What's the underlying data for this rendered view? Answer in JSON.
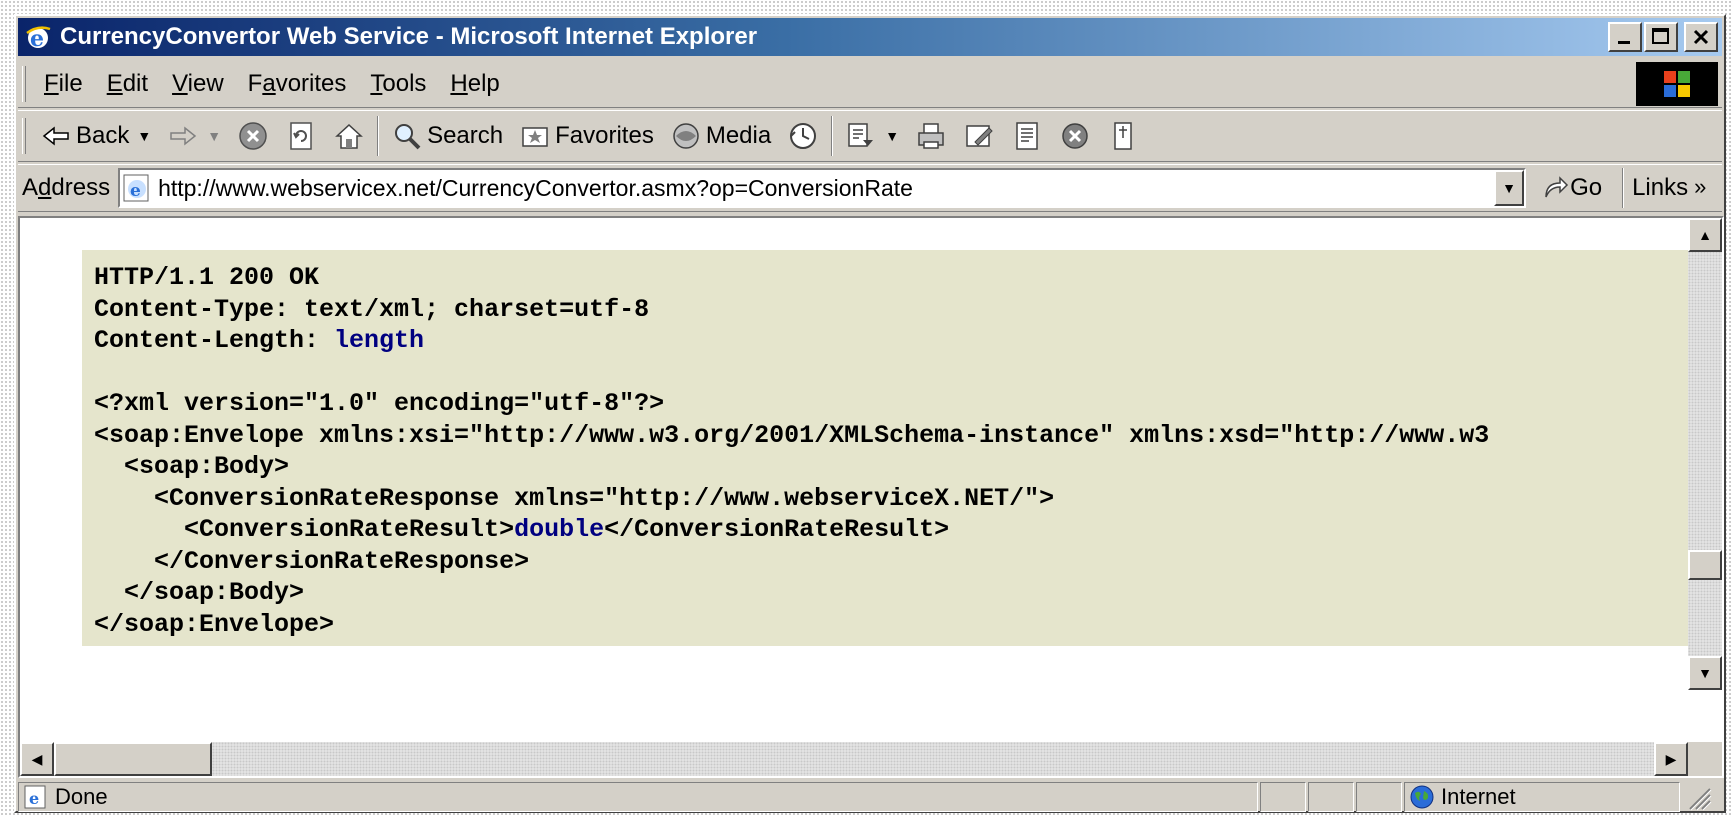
{
  "window": {
    "title": "CurrencyConvertor Web Service - Microsoft Internet Explorer",
    "controls": {
      "minimize": "_",
      "maximize": "□",
      "close": "✕"
    }
  },
  "menu": {
    "items": [
      {
        "prefix": "",
        "accel": "F",
        "rest": "ile"
      },
      {
        "prefix": "",
        "accel": "E",
        "rest": "dit"
      },
      {
        "prefix": "",
        "accel": "V",
        "rest": "iew"
      },
      {
        "prefix": "F",
        "accel": "a",
        "rest": "vorites"
      },
      {
        "prefix": "",
        "accel": "T",
        "rest": "ools"
      },
      {
        "prefix": "",
        "accel": "H",
        "rest": "elp"
      }
    ]
  },
  "toolbar": {
    "back_label": "Back",
    "search_label": "Search",
    "favorites_label": "Favorites",
    "media_label": "Media"
  },
  "address": {
    "label_prefix": "A",
    "label_accel": "d",
    "label_rest": "dress",
    "url": "http://www.webservicex.net/CurrencyConvertor.asmx?op=ConversionRate",
    "go_label": "Go",
    "links_label": "Links",
    "links_chevron": "»"
  },
  "code": {
    "line1": "HTTP/1.1 200 OK",
    "line2": "Content-Type: text/xml; charset=utf-8",
    "line3_key": "Content-Length: ",
    "line3_val": "length",
    "line4": "",
    "line5": "<?xml version=\"1.0\" encoding=\"utf-8\"?>",
    "line6": "<soap:Envelope xmlns:xsi=\"http://www.w3.org/2001/XMLSchema-instance\" xmlns:xsd=\"http://www.w3",
    "line7": "  <soap:Body>",
    "line8": "    <ConversionRateResponse xmlns=\"http://www.webserviceX.NET/\">",
    "line9_open": "      <ConversionRateResult>",
    "line9_val": "double",
    "line9_close": "</ConversionRateResult>",
    "line10": "    </ConversionRateResponse>",
    "line11": "  </soap:Body>",
    "line12": "</soap:Envelope>"
  },
  "status": {
    "text": "Done",
    "zone": "Internet"
  },
  "colors": {
    "title_gradient_start": "#0a246a",
    "title_gradient_end": "#a6caf0",
    "chrome": "#d4d0c8",
    "code_bg": "#e5e5cc",
    "placeholder_text": "#000080"
  }
}
